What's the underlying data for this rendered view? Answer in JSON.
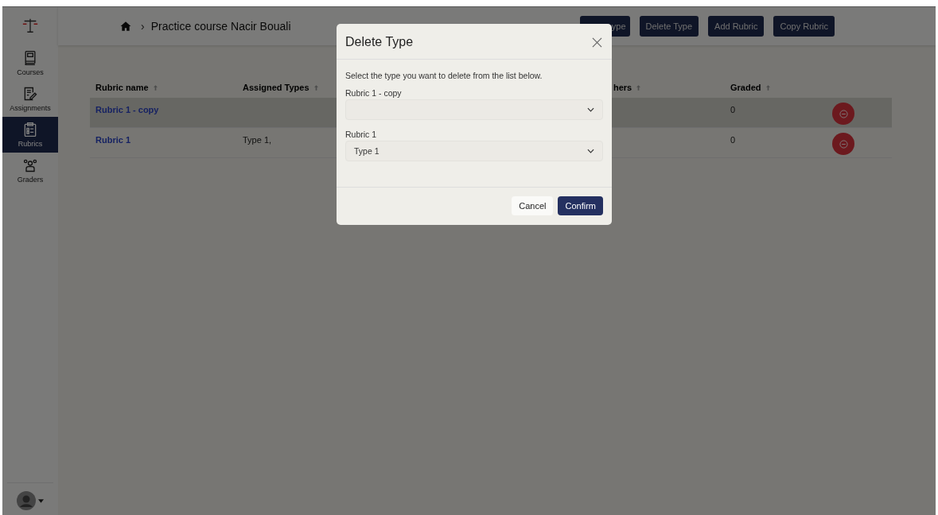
{
  "sidebar": {
    "items": [
      {
        "label": "Courses",
        "kind": "book",
        "selected": false
      },
      {
        "label": "Assignments",
        "kind": "edit",
        "selected": false
      },
      {
        "label": "Rubrics",
        "kind": "clipboard",
        "selected": true
      },
      {
        "label": "Graders",
        "kind": "people",
        "selected": false
      }
    ]
  },
  "header": {
    "separator": "›",
    "breadcrumb": "Practice course Nacir Bouali",
    "buttons": [
      "ype",
      "Delete Type",
      "Add Rubric",
      "Copy Rubric"
    ]
  },
  "table": {
    "columns": [
      "Rubric name",
      "Assigned Types",
      "hers",
      "Graded"
    ],
    "rows": [
      {
        "rubric_name": "Rubric 1 - copy",
        "graded": "0",
        "selected": true
      },
      {
        "rubric_name": "Rubric 1",
        "assigned_types": "Type 1,",
        "graded": "0",
        "selected": false
      }
    ]
  },
  "dialog": {
    "title": "Delete Type",
    "instruction": "Select the type you want to delete from the list below.",
    "fields": [
      {
        "label": "Rubric 1 - copy"
      },
      {
        "label": "Rubric 1",
        "value": "Type 1"
      }
    ],
    "cancel": "Cancel",
    "confirm": "Confirm"
  }
}
